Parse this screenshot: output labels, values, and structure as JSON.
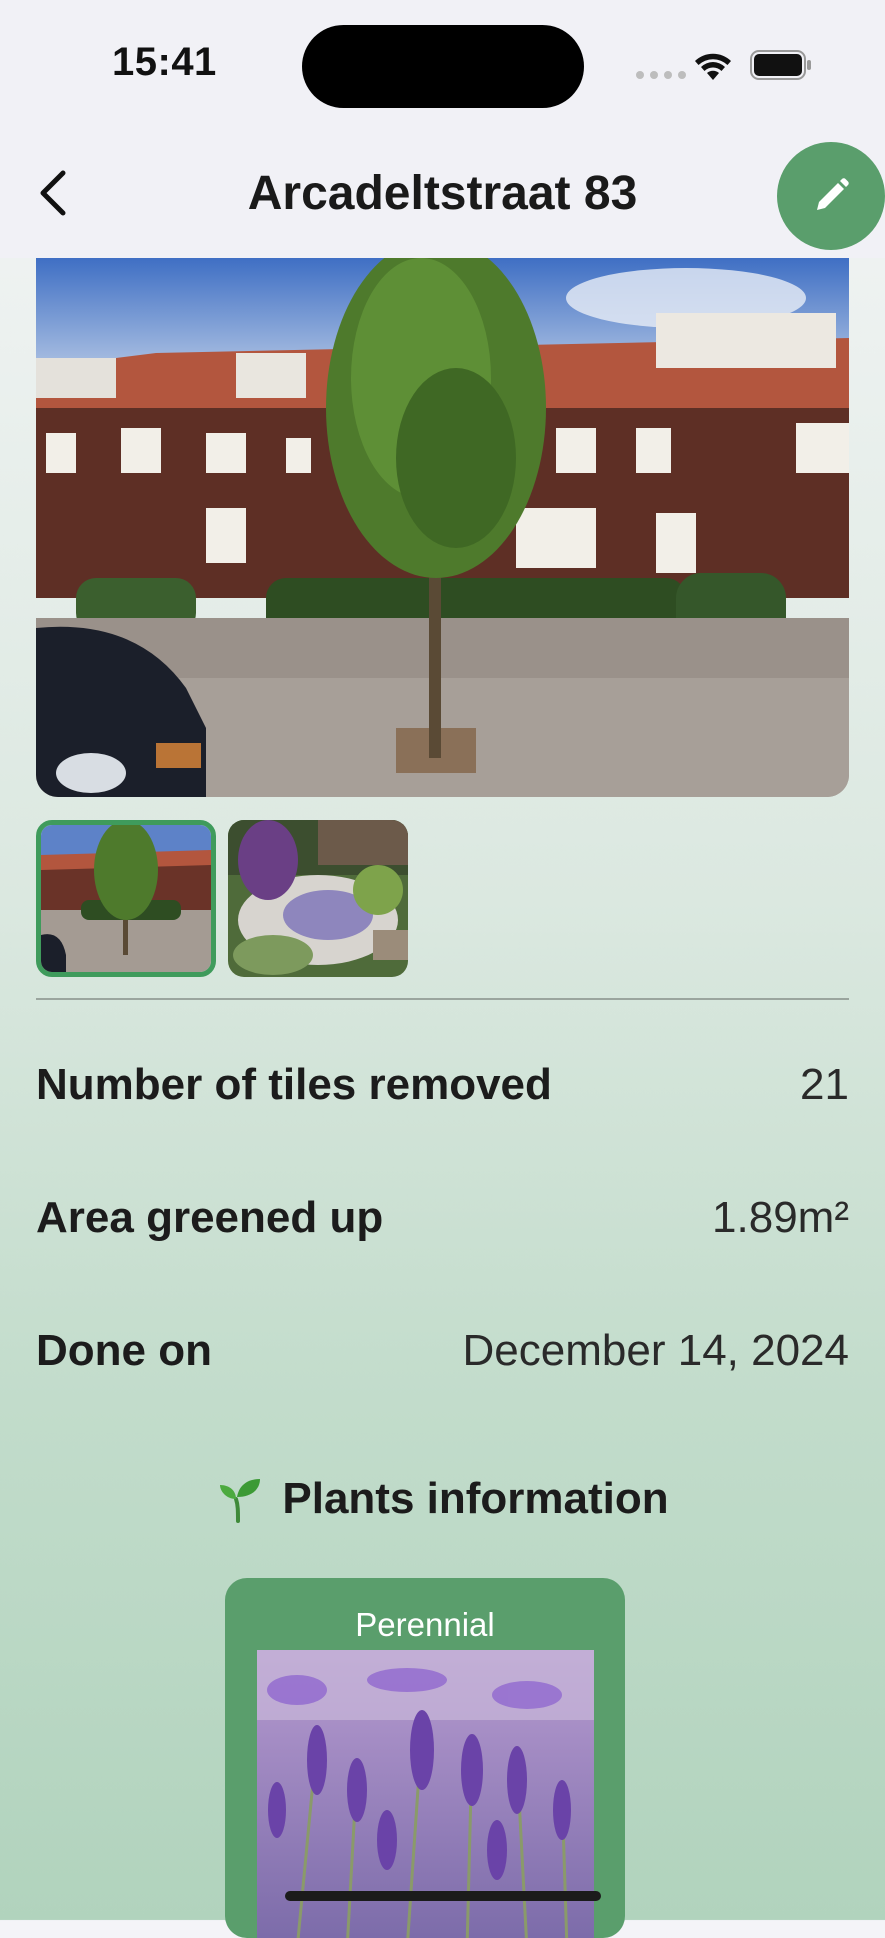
{
  "status_bar": {
    "time": "15:41",
    "icons": [
      "cellular-dots-icon",
      "wifi-icon",
      "battery-icon"
    ]
  },
  "nav": {
    "title": "Arcadeltstraat 83",
    "back_icon": "chevron-left-icon",
    "edit_icon": "pencil-icon"
  },
  "photos": {
    "main": "street-photo",
    "thumbnails": [
      {
        "name": "street-photo",
        "selected": true
      },
      {
        "name": "garden-photo",
        "selected": false
      }
    ]
  },
  "stats": [
    {
      "label": "Number of tiles removed",
      "value": "21"
    },
    {
      "label": "Area greened up",
      "value": "1.89m²"
    },
    {
      "label": "Done on",
      "value": "December 14, 2024"
    }
  ],
  "plants": {
    "header": "Plants information",
    "icon": "sprout-icon",
    "cards": [
      {
        "category": "Perennial",
        "image": "lavender-photo"
      }
    ]
  },
  "colors": {
    "accent": "#5a9e6c",
    "selected_border": "#3f9b5c",
    "bar_background": "#f1f1f6"
  }
}
